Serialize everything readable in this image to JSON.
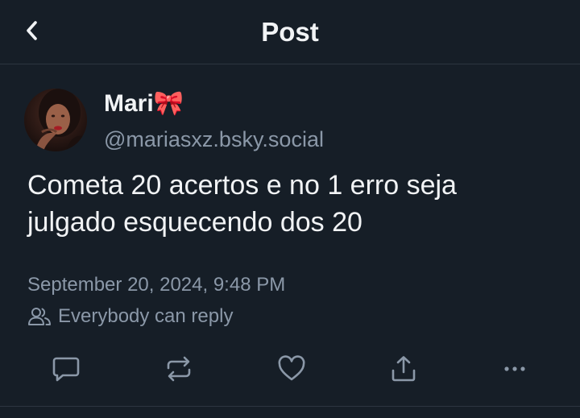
{
  "header": {
    "title": "Post",
    "back_icon": "chevron-left-icon"
  },
  "author": {
    "display_name": "Mari🎀",
    "handle": "@mariasxz.bsky.social",
    "avatar_icon": "user-avatar"
  },
  "post": {
    "text": "Cometa 20 acertos e no 1 erro seja julgado esquecendo dos 20",
    "timestamp": "September 20, 2024, 9:48 PM",
    "reply_setting": "Everybody can reply",
    "reply_setting_icon": "people-icon"
  },
  "actions": [
    {
      "name": "reply",
      "icon": "speech-bubble-icon"
    },
    {
      "name": "repost",
      "icon": "repost-arrows-icon"
    },
    {
      "name": "like",
      "icon": "heart-icon"
    },
    {
      "name": "share",
      "icon": "share-upload-icon"
    },
    {
      "name": "more",
      "icon": "ellipsis-icon"
    }
  ],
  "colors": {
    "background": "#161e27",
    "text_primary": "#f1f3f5",
    "text_secondary": "#8b98a8",
    "divider": "#2c3540"
  }
}
